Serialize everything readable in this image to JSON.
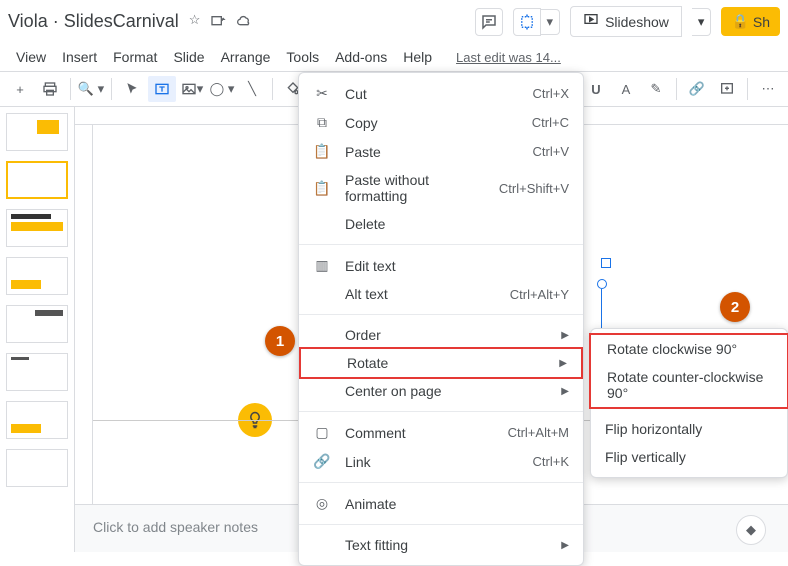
{
  "titlebar": {
    "doc_title": "Viola · SlidesCarnival",
    "star_icon": "☆",
    "move_icon": "⊕",
    "cloud_icon": "☁",
    "comment_icon": "▤",
    "slideshow_label": "Slideshow",
    "share_label": "Sh"
  },
  "menubar": {
    "items": [
      "View",
      "Insert",
      "Format",
      "Slide",
      "Arrange",
      "Tools",
      "Add-ons",
      "Help"
    ],
    "last_edit": "Last edit was 14..."
  },
  "context_menu": {
    "cut": "Cut",
    "cut_sc": "Ctrl+X",
    "copy": "Copy",
    "copy_sc": "Ctrl+C",
    "paste": "Paste",
    "paste_sc": "Ctrl+V",
    "paste_wf": "Paste without formatting",
    "paste_wf_sc": "Ctrl+Shift+V",
    "delete": "Delete",
    "edit_text": "Edit text",
    "alt_text": "Alt text",
    "alt_text_sc": "Ctrl+Alt+Y",
    "order": "Order",
    "rotate": "Rotate",
    "center": "Center on page",
    "comment": "Comment",
    "comment_sc": "Ctrl+Alt+M",
    "link": "Link",
    "link_sc": "Ctrl+K",
    "animate": "Animate",
    "text_fitting": "Text fitting"
  },
  "submenu": {
    "rotate_cw": "Rotate clockwise 90°",
    "rotate_ccw": "Rotate counter-clockwise 90°",
    "flip_h": "Flip horizontally",
    "flip_v": "Flip vertically"
  },
  "annotations": {
    "step1": "1",
    "step2": "2"
  },
  "speaker_notes": {
    "placeholder": "Click to add speaker notes"
  }
}
